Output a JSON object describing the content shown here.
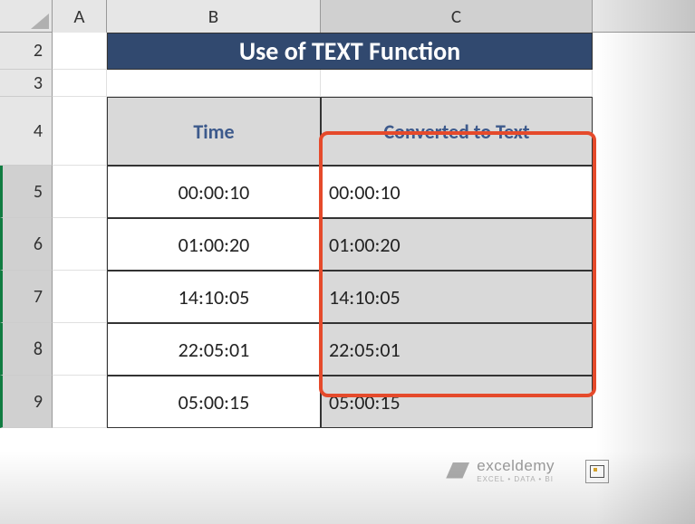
{
  "columns": {
    "a": "A",
    "b": "B",
    "c": "C"
  },
  "rows": {
    "r2": "2",
    "r3": "3",
    "r4": "4",
    "r5": "5",
    "r6": "6",
    "r7": "7",
    "r8": "8",
    "r9": "9"
  },
  "title": "Use of TEXT Function",
  "headers": {
    "time": "Time",
    "converted": "Converted to Text"
  },
  "data": [
    {
      "time": "00:00:10",
      "converted": "00:00:10"
    },
    {
      "time": "01:00:20",
      "converted": "01:00:20"
    },
    {
      "time": "14:10:05",
      "converted": "14:10:05"
    },
    {
      "time": "22:05:01",
      "converted": "22:05:01"
    },
    {
      "time": "05:00:15",
      "converted": "05:00:15"
    }
  ],
  "watermark": {
    "name": "exceldemy",
    "tag": "EXCEL • DATA • BI"
  }
}
